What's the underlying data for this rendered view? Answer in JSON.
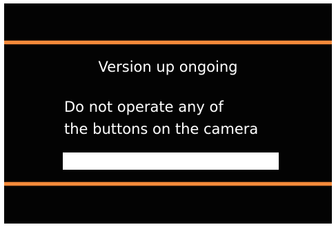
{
  "dialog": {
    "title": "Version up ongoing",
    "message_line1": "Do not operate any of",
    "message_line2": "the buttons on the camera"
  },
  "progress": {
    "fraction": 1.0
  },
  "colors": {
    "background": "#030303",
    "accent_stripe": "#f58a3a",
    "text": "#ffffff",
    "progress_fill": "#ffffff"
  }
}
